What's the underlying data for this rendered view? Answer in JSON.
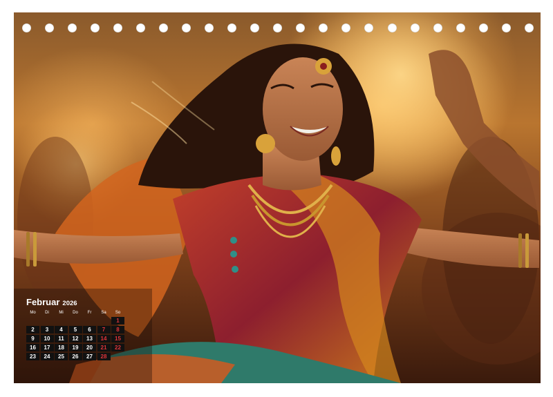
{
  "calendar": {
    "month": "Februar",
    "year": "2026",
    "weekdays": [
      "Mo",
      "Di",
      "Mi",
      "Do",
      "Fr",
      "Sa",
      "So"
    ],
    "leading_blanks": 6,
    "days": [
      "1",
      "2",
      "3",
      "4",
      "5",
      "6",
      "7",
      "8",
      "9",
      "10",
      "11",
      "12",
      "13",
      "14",
      "15",
      "16",
      "17",
      "18",
      "19",
      "20",
      "21",
      "22",
      "23",
      "24",
      "25",
      "26",
      "27",
      "28"
    ]
  },
  "binding": {
    "hole_count": 23
  }
}
